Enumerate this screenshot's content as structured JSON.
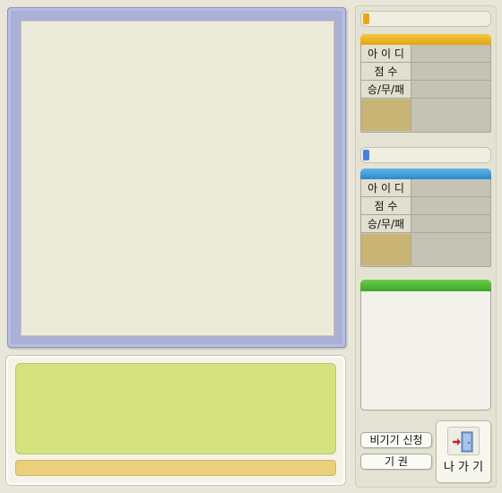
{
  "player1": {
    "accent_color": "#f0a316",
    "header_color": "#eab021",
    "labels": {
      "id": "아 이 디",
      "score": "점 수",
      "record": "승/무/패"
    },
    "id_value": "",
    "score_value": "",
    "record_value": ""
  },
  "player2": {
    "accent_color": "#4a7fe3",
    "header_color": "#3b9ad8",
    "labels": {
      "id": "아 이 디",
      "score": "점 수",
      "record": "승/무/패"
    },
    "id_value": "",
    "score_value": "",
    "record_value": ""
  },
  "spectator": {
    "header_color": "#4fb834"
  },
  "buttons": {
    "draw_request": "비기기 신청",
    "resign": "기 권",
    "exit": "나 가 기"
  },
  "icons": {
    "exit": "exit-door-icon"
  }
}
